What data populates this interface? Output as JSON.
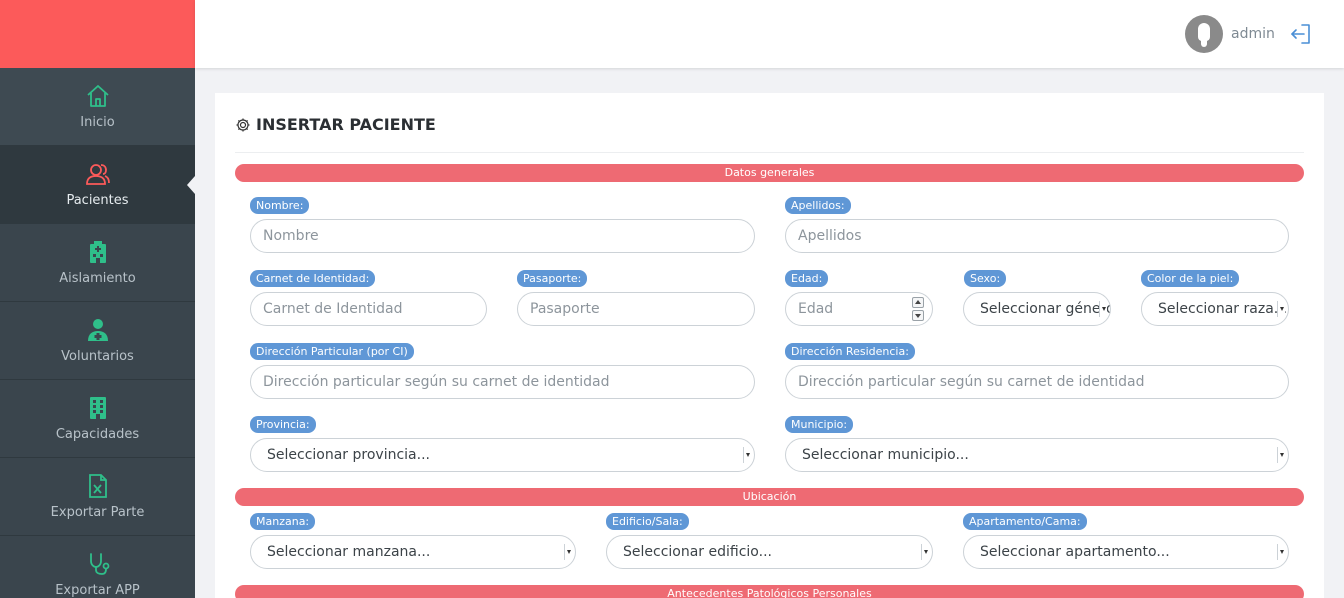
{
  "sidebar": {
    "items": [
      {
        "label": "Inicio",
        "icon": "home-icon"
      },
      {
        "label": "Pacientes",
        "icon": "patients-icon"
      },
      {
        "label": "Aislamiento",
        "icon": "hospital-icon"
      },
      {
        "label": "Voluntarios",
        "icon": "volunteer-icon"
      },
      {
        "label": "Capacidades",
        "icon": "building-icon"
      },
      {
        "label": "Exportar Parte",
        "icon": "excel-file-icon"
      },
      {
        "label": "Exportar APP",
        "icon": "stethoscope-icon"
      }
    ]
  },
  "header": {
    "user": "admin"
  },
  "colors": {
    "brand": "#fc5a5a",
    "sidebar": "#3a454d",
    "accent_green": "#2fbf8a",
    "accent_red": "#fc5a5a",
    "section": "#ee6a73",
    "label": "#5f97d6"
  },
  "form": {
    "title": "INSERTAR PACIENTE",
    "sections": {
      "general": "Datos generales",
      "location": "Ubicación",
      "history": "Antecedentes Patológicos Personales"
    },
    "fields": {
      "nombre": {
        "label": "Nombre:",
        "placeholder": "Nombre"
      },
      "apellidos": {
        "label": "Apellidos:",
        "placeholder": "Apellidos"
      },
      "carnet": {
        "label": "Carnet de Identidad:",
        "placeholder": "Carnet de Identidad"
      },
      "pasaporte": {
        "label": "Pasaporte:",
        "placeholder": "Pasaporte"
      },
      "edad": {
        "label": "Edad:",
        "placeholder": "Edad"
      },
      "sexo": {
        "label": "Sexo:",
        "value": "Seleccionar género..."
      },
      "color_piel": {
        "label": "Color de la piel:",
        "value": "Seleccionar raza..."
      },
      "dir_particular": {
        "label": "Dirección Particular (por CI)",
        "placeholder": "Dirección particular según su carnet de identidad"
      },
      "dir_residencia": {
        "label": "Dirección Residencia:",
        "placeholder": "Dirección particular según su carnet de identidad"
      },
      "provincia": {
        "label": "Provincia:",
        "value": "Seleccionar provincia..."
      },
      "municipio": {
        "label": "Municipio:",
        "value": "Seleccionar municipio..."
      },
      "manzana": {
        "label": "Manzana:",
        "value": "Seleccionar manzana..."
      },
      "edificio": {
        "label": "Edificio/Sala:",
        "value": "Seleccionar edificio..."
      },
      "apartamento": {
        "label": "Apartamento/Cama:",
        "value": "Seleccionar apartamento..."
      }
    }
  }
}
